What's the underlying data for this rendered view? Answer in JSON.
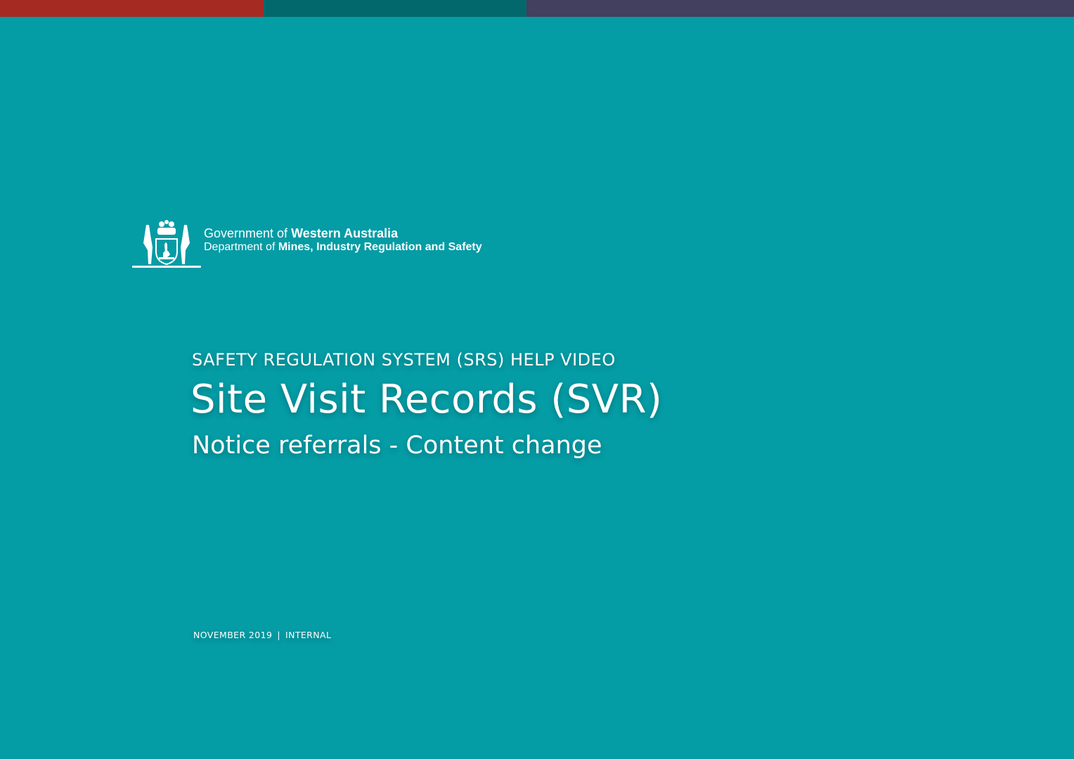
{
  "top_bars": {
    "colors": [
      "#a52a22",
      "#03686b",
      "#433f5e"
    ]
  },
  "background_color": "#049ca5",
  "logo": {
    "alt": "Government of Western Australia coat of arms",
    "line1_prefix": "Government of ",
    "line1_bold": "Western Australia",
    "line2_prefix": "Department of ",
    "line2_bold": "Mines, Industry Regulation and Safety"
  },
  "kicker": "SAFETY REGULATION SYSTEM (SRS) HELP VIDEO",
  "title": "Site Visit Records (SVR)",
  "subtitle": "Notice referrals - Content change",
  "footer": {
    "date": "NOVEMBER 2019",
    "separator": "|",
    "classification": "INTERNAL"
  }
}
